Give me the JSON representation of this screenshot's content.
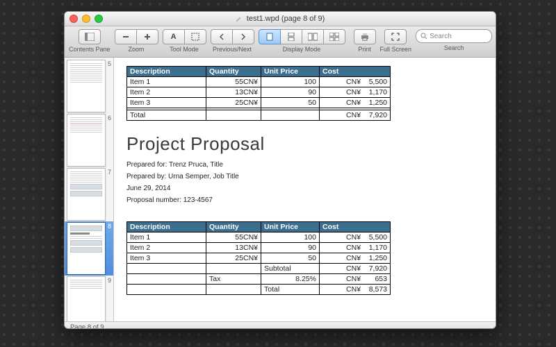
{
  "window": {
    "title": "test1.wpd (page 8 of 9)"
  },
  "toolbar": {
    "contents_pane": "Contents Pane",
    "zoom": "Zoom",
    "tool_mode": "Tool Mode",
    "prev_next": "Previous/Next",
    "display_mode": "Display Mode",
    "print": "Print",
    "full_screen": "Full Screen",
    "search": "Search",
    "search_placeholder": "Search"
  },
  "thumbnails": {
    "visible": [
      {
        "num": "5"
      },
      {
        "num": "6"
      },
      {
        "num": "7"
      },
      {
        "num": "8",
        "selected": true
      },
      {
        "num": "9"
      }
    ]
  },
  "status": "Page 8 of 9",
  "doc": {
    "table1": {
      "headers": [
        "Description",
        "Quantity",
        "Unit Price",
        "Cost"
      ],
      "rows": [
        {
          "desc": "Item 1",
          "qty": "55",
          "qty_cur": "CN¥",
          "price": "100",
          "cost_cur": "CN¥",
          "cost": "5,500"
        },
        {
          "desc": "Item 2",
          "qty": "13",
          "qty_cur": "CN¥",
          "price": "90",
          "cost_cur": "CN¥",
          "cost": "1,170"
        },
        {
          "desc": "Item 3",
          "qty": "25",
          "qty_cur": "CN¥",
          "price": "50",
          "cost_cur": "CN¥",
          "cost": "1,250"
        }
      ],
      "total_label": "Total",
      "total_cur": "CN¥",
      "total": "7,920"
    },
    "title": "Project Proposal",
    "meta": {
      "for": "Prepared for: Trenz Pruca, Title",
      "by": "Prepared by: Urna Semper, Job Title",
      "date": "June 29, 2014",
      "num": "Proposal number: 123-4567"
    },
    "table2": {
      "headers": [
        "Description",
        "Quantity",
        "Unit Price",
        "Cost"
      ],
      "rows": [
        {
          "desc": "Item 1",
          "qty": "55",
          "qty_cur": "CN¥",
          "price": "100",
          "cost_cur": "CN¥",
          "cost": "5,500"
        },
        {
          "desc": "Item 2",
          "qty": "13",
          "qty_cur": "CN¥",
          "price": "90",
          "cost_cur": "CN¥",
          "cost": "1,170"
        },
        {
          "desc": "Item 3",
          "qty": "25",
          "qty_cur": "CN¥",
          "price": "50",
          "cost_cur": "CN¥",
          "cost": "1,250"
        }
      ],
      "subtotal_label": "Subtotal",
      "subtotal_cur": "CN¥",
      "subtotal": "7,920",
      "tax_label": "Tax",
      "tax_rate": "8.25%",
      "tax_cur": "CN¥",
      "tax": "653",
      "total_label": "Total",
      "total_cur": "CN¥",
      "total": "8,573"
    }
  }
}
